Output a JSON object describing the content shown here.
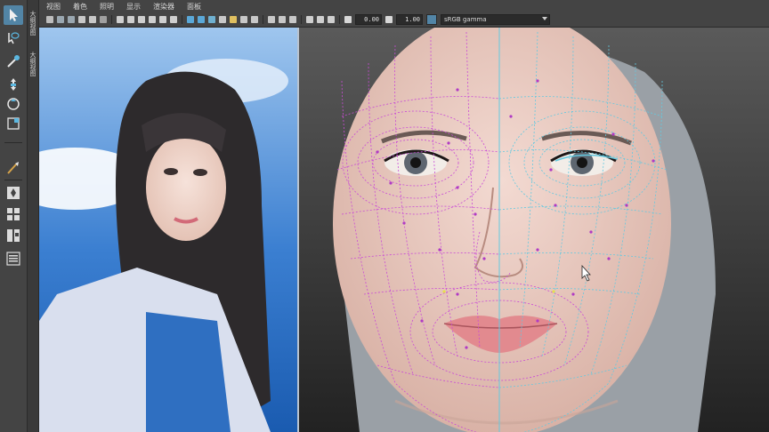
{
  "menubar": {
    "items": [
      "视图",
      "着色",
      "照明",
      "显示",
      "渲染器",
      "面板"
    ]
  },
  "toolbar": {
    "exposure_value": "0.00",
    "gamma_value": "1.00",
    "color_space": "sRGB gamma"
  },
  "side_tabs": {
    "tab1": "大纲视图",
    "tab2": "大纲视图"
  },
  "colors": {
    "accent": "#5285a6",
    "wire": "#c94bd6",
    "wire_right": "#63c9e0"
  },
  "icons": {
    "tools": [
      "select-arrow-icon",
      "lasso-icon",
      "paint-select-icon",
      "move-icon",
      "rotate-icon",
      "scale-icon",
      "brush-icon",
      "layout-single-icon",
      "layout-four-icon",
      "layout-two-icon",
      "outliner-icon"
    ]
  }
}
